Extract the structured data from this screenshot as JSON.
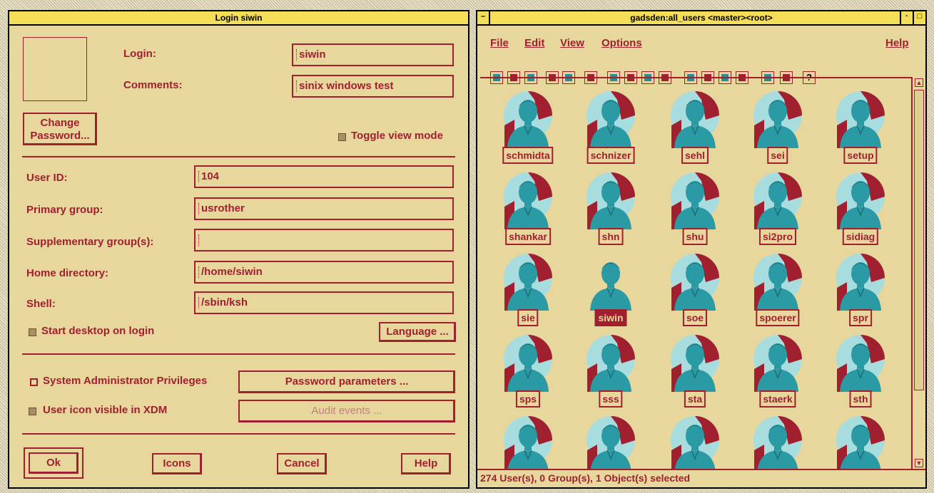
{
  "left_window": {
    "title": "Login siwin",
    "login_label": "Login:",
    "login_value": "siwin",
    "comments_label": "Comments:",
    "comments_value": "sinix windows test",
    "change_password_line1": "Change",
    "change_password_line2": "Password...",
    "toggle_view_label": "Toggle view mode",
    "user_id_label": "User ID:",
    "user_id_value": "104",
    "primary_group_label": "Primary group:",
    "primary_group_value": "usrother",
    "supp_groups_label": "Supplementary group(s):",
    "supp_groups_value": "",
    "home_dir_label": "Home directory:",
    "home_dir_value": "/home/siwin",
    "shell_label": "Shell:",
    "shell_value": "/sbin/ksh",
    "start_desktop_label": "Start desktop on login",
    "language_button": "Language ...",
    "sysadmin_label": "System Administrator Privileges",
    "password_params_button": "Password parameters ...",
    "xdm_label": "User icon visible in XDM",
    "audit_events_button": "Audit events ...",
    "ok_button": "Ok",
    "icons_button": "Icons",
    "cancel_button": "Cancel",
    "help_button": "Help"
  },
  "right_window": {
    "title": "gadsden:all_users <master><root>",
    "menu": {
      "file": "File",
      "edit": "Edit",
      "view": "View",
      "options": "Options",
      "help": "Help"
    },
    "users": [
      "schmidta",
      "schnizer",
      "sehl",
      "sei",
      "setup",
      "shankar",
      "shn",
      "shu",
      "si2pro",
      "sidiag",
      "sie",
      "siwin",
      "soe",
      "spoerer",
      "spr",
      "sps",
      "sss",
      "sta",
      "staerk",
      "sth",
      "",
      "",
      "",
      "",
      ""
    ],
    "selected_user": "siwin",
    "status": "274 User(s), 0 Group(s), 1 Object(s) selected"
  },
  "colors": {
    "accent": "#a02030",
    "teal": "#2a8c96",
    "background": "#e8d79d",
    "titlebar": "#f4de58"
  }
}
